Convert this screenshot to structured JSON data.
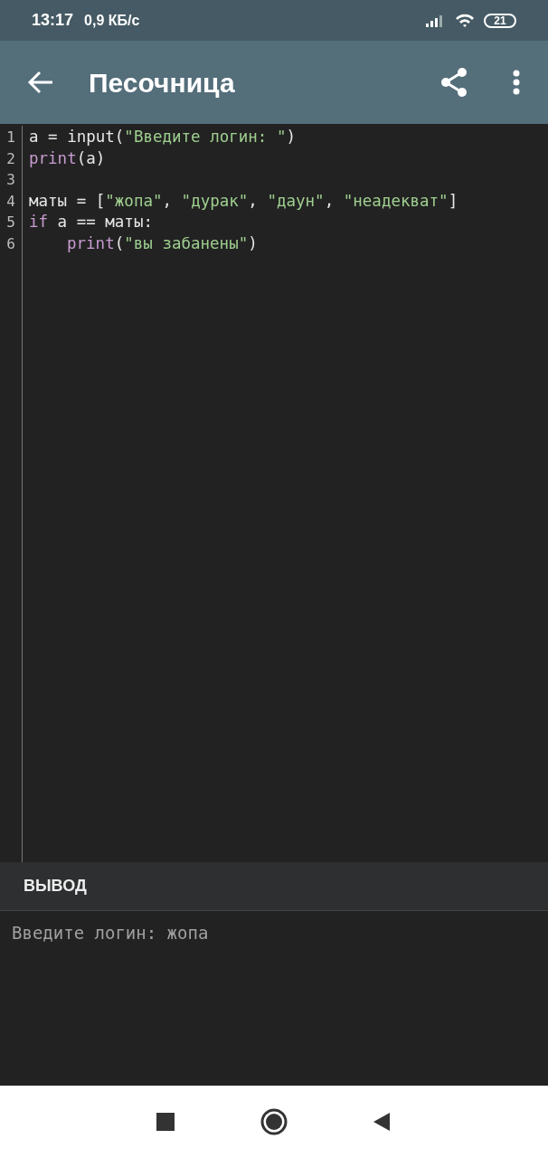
{
  "status_bar": {
    "time": "13:17",
    "speed": "0,9 КБ/с",
    "battery": "21"
  },
  "toolbar": {
    "title": "Песочница"
  },
  "editor": {
    "lines": [
      {
        "number": "1",
        "tokens": [
          {
            "kind": "plain",
            "text": "a = input("
          },
          {
            "kind": "string",
            "text": "\"Введите логин: \""
          },
          {
            "kind": "plain",
            "text": ")"
          }
        ]
      },
      {
        "number": "2",
        "tokens": [
          {
            "kind": "keyword",
            "text": "print"
          },
          {
            "kind": "plain",
            "text": "(a)"
          }
        ]
      },
      {
        "number": "3"
      },
      {
        "number": "4",
        "tokens": [
          {
            "kind": "plain",
            "text": "маты = ["
          },
          {
            "kind": "string",
            "text": "\"жопа\""
          },
          {
            "kind": "plain",
            "text": ", "
          },
          {
            "kind": "string",
            "text": "\"дурак\""
          },
          {
            "kind": "plain",
            "text": ", "
          },
          {
            "kind": "string",
            "text": "\"даун\""
          },
          {
            "kind": "plain",
            "text": ", "
          },
          {
            "kind": "string",
            "text": "\"неадекват\""
          },
          {
            "kind": "plain",
            "text": "]"
          }
        ]
      },
      {
        "number": "5",
        "tokens": [
          {
            "kind": "keyword",
            "text": "if"
          },
          {
            "kind": "plain",
            "text": " a == маты:"
          }
        ]
      },
      {
        "number": "6",
        "indented": true,
        "tokens": [
          {
            "kind": "keyword",
            "text": "print"
          },
          {
            "kind": "plain",
            "text": "("
          },
          {
            "kind": "string",
            "text": "\"вы забанены\""
          },
          {
            "kind": "plain",
            "text": ")"
          }
        ]
      }
    ]
  },
  "output": {
    "title": "ВЫВОД",
    "text": "Введите логин: жопа"
  }
}
